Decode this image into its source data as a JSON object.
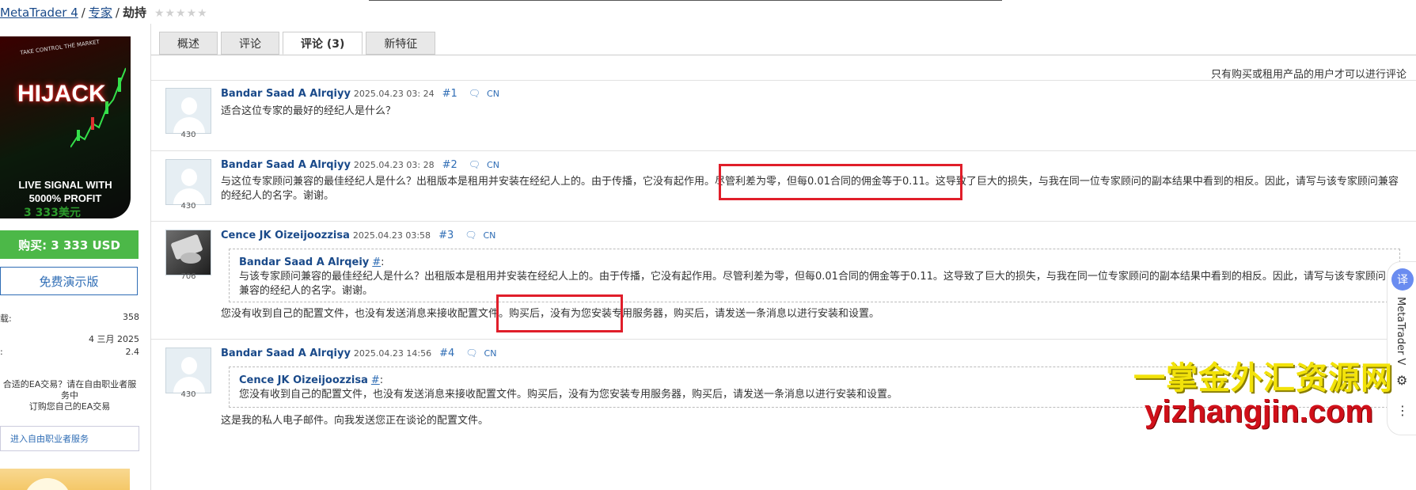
{
  "breadcrumb": {
    "root": "MetaTrader 4",
    "sep1": "/",
    "section": "专家",
    "sep2": "/",
    "current": "劫持",
    "stars": "★★★★★"
  },
  "product": {
    "image_title": "HIJACK",
    "image_tag": "TAKE CONTROL THE MARKET",
    "image_line1": "LIVE SIGNAL WITH",
    "image_line2": "5000% PROFIT",
    "price": "3 333美元",
    "buy_label": "购买: 3 333 USD",
    "demo_label": "免费演示版",
    "info": [
      {
        "label": "载:",
        "value": "358"
      },
      {
        "label": "",
        "value": "4 三月 2025"
      },
      {
        "label": ":",
        "value": "2.4"
      }
    ],
    "freelance_text_1": "合适的EA交易？请在自由职业者服务中",
    "freelance_text_2": "订购您自己的EA交易",
    "freelance_button": "进入自由职业者服务"
  },
  "tabs": [
    {
      "label": "概述",
      "active": false
    },
    {
      "label": "评论",
      "active": false
    },
    {
      "label": "评论 (3)",
      "active": true
    },
    {
      "label": "新特征",
      "active": false
    }
  ],
  "notice": "只有购买或租用产品的用户才可以进行评论",
  "comments": [
    {
      "author": "Bandar Saad A Alrqiyy",
      "date": "2025.04.23 03: 24",
      "num": "#1",
      "lang": "CN",
      "rating": "430",
      "text": "适合这位专家的最好的经纪人是什么？"
    },
    {
      "author": "Bandar Saad A Alrqiyy",
      "date": "2025.04.23 03: 28",
      "num": "#2",
      "lang": "CN",
      "rating": "430",
      "text": "与这位专家顾问兼容的最佳经纪人是什么？出租版本是租用并安装在经纪人上的。由于传播，它没有起作用。尽管利差为零，但每0.01合同的佣金等于0.11。这导致了巨大的损失，与我在同一位专家顾问的副本结果中看到的相反。因此，请写与该专家顾问兼容的经纪人的名字。谢谢。"
    },
    {
      "author": "Cence JK Oizeijoozzisa",
      "date": "2025.04.23 03:58",
      "num": "#3",
      "lang": "CN",
      "rating": "706",
      "quote_author": "Bandar Saad A Alrqeiy",
      "quote_hash": "#",
      "quote_colon": ":",
      "quote_text": "与该专家顾问兼容的最佳经纪人是什么？出租版本是租用并安装在经纪人上的。由于传播，它没有起作用。尽管利差为零，但每0.01合同的佣金等于0.11。这导致了巨大的损失，与我在同一位专家顾问的副本结果中看到的相反。因此，请写与该专家顾问兼容的经纪人的名字。谢谢。",
      "text": "您没有收到自己的配置文件，也没有发送消息来接收配置文件。购买后，没有为您安装专用服务器，购买后，请发送一条消息以进行安装和设置。"
    },
    {
      "author": "Bandar Saad A Alrqiyy",
      "date": "2025.04.23 14:56",
      "num": "#4",
      "lang": "CN",
      "rating": "430",
      "quote_author": "Cence JK Oizeijoozzisa",
      "quote_hash": "#",
      "quote_colon": ":",
      "quote_text": "您没有收到自己的配置文件，也没有发送消息来接收配置文件。购买后，没有为您安装专用服务器，购买后，请发送一条消息以进行安装和设置。",
      "text": "这是我的私人电子邮件。向我发送您正在谈论的配置文件。"
    }
  ],
  "side_widget": {
    "translate": "译",
    "title": "MetaTrader V"
  },
  "watermark": {
    "line1": "一掌金外汇资源网",
    "line2": "yizhangjin.com"
  },
  "colors": {
    "link": "#1a4a8a",
    "buy_green": "#4cb848",
    "price_green": "#2c9c2c",
    "highlight_red": "#e01e2a",
    "watermark_yellow": "#f2e20a"
  }
}
